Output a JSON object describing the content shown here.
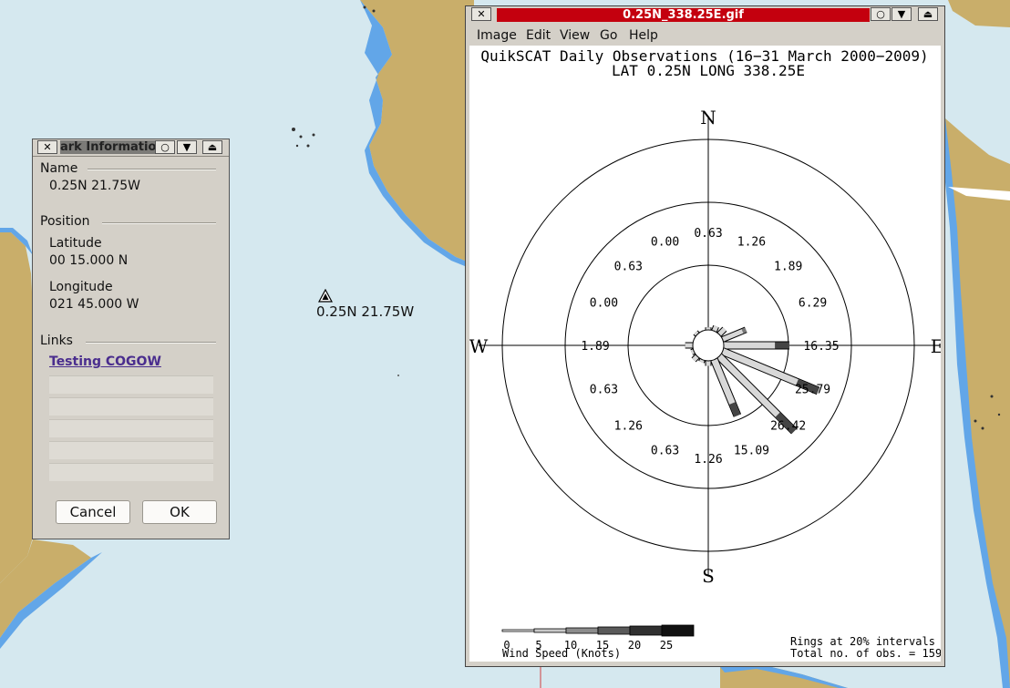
{
  "map": {
    "mark_label": "0.25N 21.75W"
  },
  "mark_dialog": {
    "title": "ark Informatio",
    "sections": {
      "name": "Name",
      "position": "Position",
      "links": "Links"
    },
    "name_value": "0.25N 21.75W",
    "latitude_label": "Latitude",
    "latitude_value": "00 15.000 N",
    "longitude_label": "Longitude",
    "longitude_value": "021 45.000 W",
    "link_text": "Testing COGOW",
    "cancel_label": "Cancel",
    "ok_label": "OK"
  },
  "gif_window": {
    "title": "0.25N_338.25E.gif",
    "menu": [
      "Image",
      "Edit",
      "View",
      "Go",
      "Help"
    ]
  },
  "chart_data": {
    "type": "wind-rose",
    "title": "QuikSCAT Daily Observations (16−31 March 2000−2009)",
    "subtitle": "LAT 0.25N LONG 338.25E",
    "cardinals": {
      "n": "N",
      "e": "E",
      "s": "S",
      "w": "W"
    },
    "ring_note": "Rings at 20% intervals",
    "total_note": "Total no. of obs. = 159",
    "legend_title": "Wind Speed (Knots)",
    "legend_ticks": [
      "0",
      "5",
      "10",
      "15",
      "20",
      "25"
    ],
    "speed_bins": [
      {
        "label": "0-5",
        "color": "#ffffff"
      },
      {
        "label": "5-10",
        "color": "#c8c8c8"
      },
      {
        "label": "10-15",
        "color": "#8c8c8c"
      },
      {
        "label": "15-20",
        "color": "#5a5a5a"
      },
      {
        "label": "20-25",
        "color": "#303030"
      },
      {
        "label": "25+",
        "color": "#111111"
      }
    ],
    "directions": [
      {
        "deg": 0,
        "percent": "0.63"
      },
      {
        "deg": 22.5,
        "percent": "1.26"
      },
      {
        "deg": 45,
        "percent": "1.89"
      },
      {
        "deg": 67.5,
        "percent": "6.29"
      },
      {
        "deg": 90,
        "percent": "16.35"
      },
      {
        "deg": 112.5,
        "percent": "25.79"
      },
      {
        "deg": 135,
        "percent": "26.42"
      },
      {
        "deg": 157.5,
        "percent": "15.09"
      },
      {
        "deg": 180,
        "percent": "1.26"
      },
      {
        "deg": 202.5,
        "percent": "0.63"
      },
      {
        "deg": 225,
        "percent": "1.26"
      },
      {
        "deg": 247.5,
        "percent": "0.63"
      },
      {
        "deg": 270,
        "percent": "1.89"
      },
      {
        "deg": 292.5,
        "percent": "0.00"
      },
      {
        "deg": 315,
        "percent": "0.63"
      },
      {
        "deg": 337.5,
        "percent": "0.00"
      }
    ]
  }
}
